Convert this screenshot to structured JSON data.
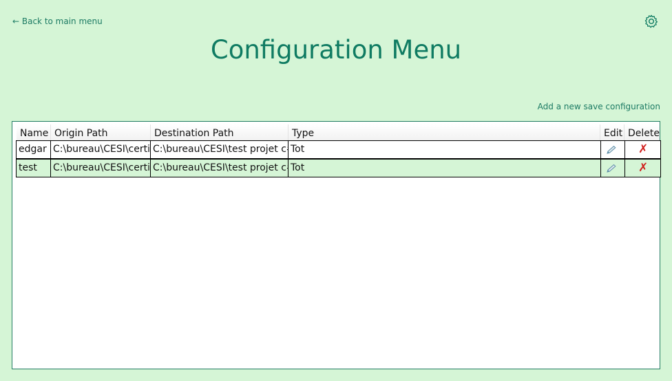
{
  "header": {
    "back_label": "← Back to main menu",
    "title": "Configuration Menu",
    "settings_icon": "gear-icon"
  },
  "actions": {
    "add_label": "Add a new save configuration"
  },
  "grid": {
    "columns": [
      "Name",
      "Origin Path",
      "Destination Path",
      "Type",
      "Edit",
      "Delete"
    ],
    "rows": [
      {
        "name": "edgar",
        "origin": "C:\\bureau\\CESI\\certif",
        "destination": "C:\\bureau\\CESI\\test projet c#",
        "type": "Tot",
        "edit_icon": "pencil-icon",
        "delete_icon": "cross-icon",
        "delete_glyph": "✗"
      },
      {
        "name": "test",
        "origin": "C:\\bureau\\CESI\\certif",
        "destination": "C:\\bureau\\CESI\\test projet c#",
        "type": "Tot",
        "edit_icon": "pencil-icon",
        "delete_icon": "cross-icon",
        "delete_glyph": "✗"
      }
    ]
  },
  "colors": {
    "background": "#d5f5d6",
    "accent": "#0f7b62",
    "delete": "#d0201d"
  }
}
